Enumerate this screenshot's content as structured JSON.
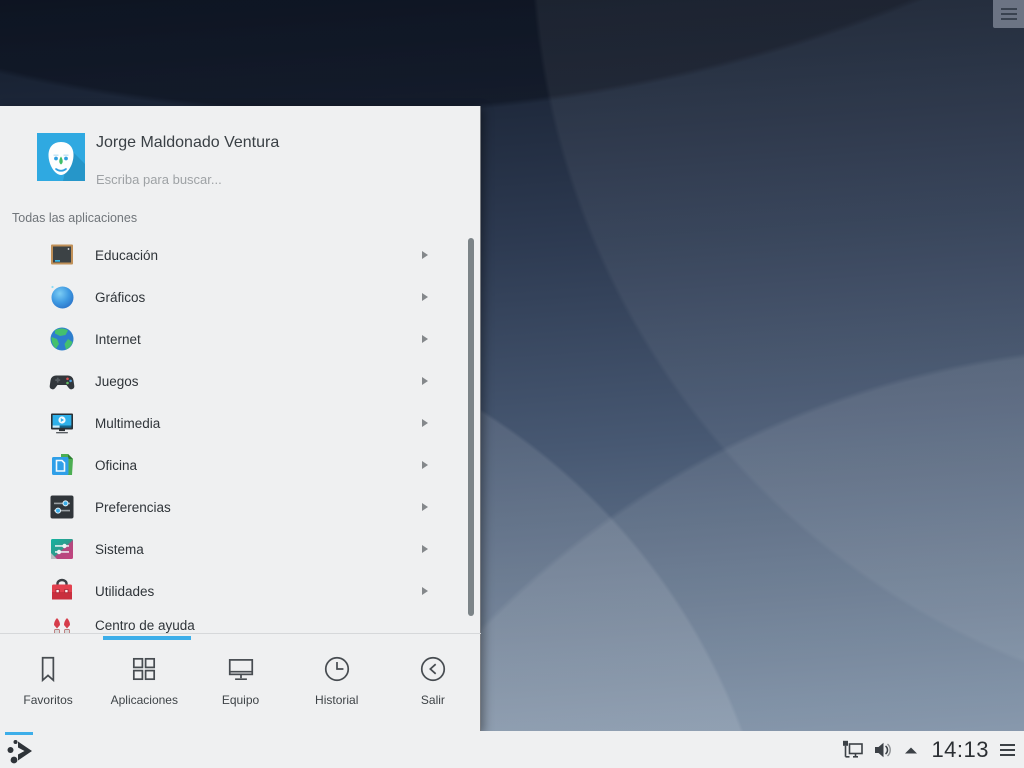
{
  "colors": {
    "accent": "#3daee9",
    "menu_background": "#eff0f1",
    "text_dark": "#31363b",
    "text_muted": "#9ea2a5",
    "wallpaper_top": "#121b2a",
    "wallpaper_bottom": "#8295ab"
  },
  "desktop": {
    "panel_toggle_icon": "hamburger-menu-icon"
  },
  "launcher_menu": {
    "user_name": "Jorge Maldonado Ventura",
    "search_placeholder": "Escriba para buscar...",
    "breadcrumb": "Todas las aplicaciones",
    "categories": [
      {
        "label": "Educación",
        "icon": "education-icon",
        "has_submenu": true
      },
      {
        "label": "Gráficos",
        "icon": "graphics-icon",
        "has_submenu": true
      },
      {
        "label": "Internet",
        "icon": "internet-icon",
        "has_submenu": true
      },
      {
        "label": "Juegos",
        "icon": "games-icon",
        "has_submenu": true
      },
      {
        "label": "Multimedia",
        "icon": "multimedia-icon",
        "has_submenu": true
      },
      {
        "label": "Oficina",
        "icon": "office-icon",
        "has_submenu": true
      },
      {
        "label": "Preferencias",
        "icon": "preferences-icon",
        "has_submenu": true
      },
      {
        "label": "Sistema",
        "icon": "system-icon",
        "has_submenu": true
      },
      {
        "label": "Utilidades",
        "icon": "utilities-icon",
        "has_submenu": true
      },
      {
        "label": "Centro de ayuda",
        "icon": "help-center-icon",
        "has_submenu": false
      }
    ],
    "tabs": [
      {
        "label": "Favoritos",
        "icon": "favorites-icon",
        "active": false
      },
      {
        "label": "Aplicaciones",
        "icon": "applications-icon",
        "active": true
      },
      {
        "label": "Equipo",
        "icon": "computer-icon",
        "active": false
      },
      {
        "label": "Historial",
        "icon": "history-icon",
        "active": false
      },
      {
        "label": "Salir",
        "icon": "logout-icon",
        "active": false
      }
    ]
  },
  "taskbar": {
    "launcher_icon": "app-launcher-icon",
    "tray_icons": [
      "wired-network-icon",
      "volume-icon",
      "expand-tray-icon"
    ],
    "clock": "14:13",
    "overflow_icon": "hamburger-menu-icon"
  }
}
